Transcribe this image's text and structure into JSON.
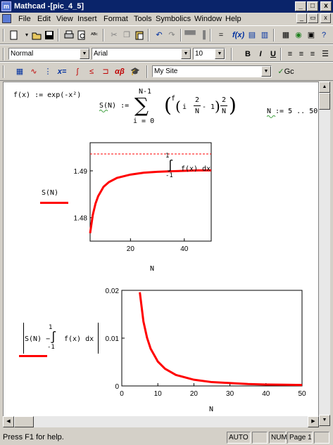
{
  "window": {
    "app_icon": "m",
    "title": "Mathcad -[pic_4_5]"
  },
  "title_buttons": {
    "minimize": "_",
    "maximize": "□",
    "close": "x",
    "doc_minimize": "_",
    "doc_restore": "▭",
    "doc_close": "x"
  },
  "menu": [
    "File",
    "Edit",
    "View",
    "Insert",
    "Format",
    "Tools",
    "Symbolics",
    "Window",
    "Help"
  ],
  "format_bar": {
    "style": "Normal",
    "font": "Arial",
    "size": "10",
    "bold": "B",
    "italic": "I",
    "underline": "U"
  },
  "math_bar": {
    "location": "My Site",
    "go": "Gc"
  },
  "document": {
    "f_def": "f(x) := exp(-x²)",
    "s_left": "S(N) :=",
    "sum_top": "N-1",
    "sum_bottom": "i = 0",
    "sum_body_f": "f",
    "sum_body_i": "i",
    "sum_body_2": "2",
    "sum_body_N": "N",
    "sum_body_minus1": "- 1",
    "sum_mult_2": "2",
    "sum_mult_N": "N",
    "n_range": "N := 5 .. 50",
    "plot1": {
      "ylabel": "S(N)",
      "integral_label": "f(x) dx",
      "integral_upper": "1",
      "integral_lower": "-1",
      "xlabel": "N",
      "yticks": [
        "1.49",
        "1.48"
      ],
      "xticks": [
        "20",
        "40"
      ]
    },
    "plot2": {
      "ylabel_left": "S(N) −",
      "integral_label": "f(x) dx",
      "integral_upper": "1",
      "integral_lower": "-1",
      "xlabel": "N",
      "yticks": [
        "0.02",
        "0.01",
        "0"
      ],
      "xticks": [
        "0",
        "10",
        "20",
        "30",
        "40",
        "50"
      ]
    }
  },
  "chart_data": [
    {
      "type": "line",
      "x": [
        5,
        6,
        7,
        8,
        10,
        12,
        15,
        20,
        25,
        30,
        35,
        40,
        45,
        50
      ],
      "series": [
        {
          "values": [
            1.4767,
            1.4806,
            1.483,
            1.4846,
            1.4866,
            1.4876,
            1.4885,
            1.4892,
            1.4896,
            1.4898,
            1.4899,
            1.49,
            1.4901,
            1.4901
          ]
        }
      ],
      "reference_line": 1.4936,
      "ylim": [
        1.475,
        1.496
      ],
      "xlim": [
        5,
        50
      ],
      "xlabel": "N",
      "ylabel": "S(N)"
    },
    {
      "type": "line",
      "x": [
        5,
        6,
        7,
        8,
        10,
        12,
        15,
        20,
        25,
        30,
        35,
        40,
        45,
        50
      ],
      "series": [
        {
          "values": [
            0.0196,
            0.0135,
            0.0101,
            0.0078,
            0.0051,
            0.0036,
            0.0023,
            0.0013,
            0.0008,
            0.0006,
            0.0004,
            0.0003,
            0.00025,
            0.0002
          ]
        }
      ],
      "ylim": [
        0,
        0.02
      ],
      "xlim": [
        0,
        50
      ],
      "xlabel": "N"
    }
  ],
  "status": {
    "message": "Press F1 for help.",
    "mode": "AUTO",
    "num": "NUM",
    "page": "Page 1"
  },
  "colors": {
    "curve": "#ff0000",
    "titlebar": "#0a246a",
    "chrome": "#d4d0c8"
  }
}
